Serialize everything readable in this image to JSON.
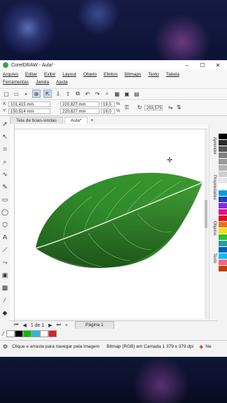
{
  "window": {
    "title": "CorelDRAW - Aula*",
    "minimize": "–",
    "maximize": "☐",
    "close": "✕"
  },
  "menu": {
    "row1": [
      "Arquivo",
      "Editar",
      "Exibir",
      "Layout",
      "Objeto",
      "Efeitos",
      "Bitmaps",
      "Texto",
      "Tabela"
    ],
    "row2": [
      "Ferramentas",
      "Janela",
      "Ajuda"
    ]
  },
  "propbar": {
    "x_label": "X:",
    "x_value": "101,415 mm",
    "y_label": "Y:",
    "y_value": "150,514 mm",
    "w_value": "220,827 mm",
    "h_value": "220,827 mm",
    "scale_w": "19,0",
    "scale_h": "19,0",
    "percent": "%",
    "angle": "293,575"
  },
  "tabs": [
    "Tela de boas-vindas",
    "Aula*"
  ],
  "tabs_add": "+",
  "side_panels": [
    "Aprender",
    "Propriedades",
    "Objetos",
    "Texto"
  ],
  "pagebar": {
    "first": "⏮",
    "prev": "◀",
    "counter": "1  de  1",
    "next": "▶",
    "last": "⏭",
    "add": "+",
    "page_tab": "Página 1"
  },
  "status": {
    "hint": "Clique e arraste para navegar pela imagem",
    "info": "Bitmap (RGB) em Camada 1  379 x 379 dpi",
    "fill_label": "Ne"
  },
  "palette_colors": [
    "#000000",
    "#2b2b2b",
    "#555555",
    "#7f7f7f",
    "#9a9a9a",
    "#b4b4b4",
    "#cfcfcf",
    "#e6e6e6",
    "#ffffff",
    "#00a0e0",
    "#1a3fd0",
    "#8a2be2",
    "#e0148c",
    "#e01020",
    "#f07010",
    "#f0e010",
    "#30c030",
    "#20a0a0",
    "#0060c0",
    "#00c0f0",
    "#ff6080",
    "#c04000"
  ],
  "colorbar_colors": [
    "#ffffff",
    "#000000",
    "#00c000",
    "#2ab8e0",
    "#ffffff",
    "#e02020"
  ]
}
